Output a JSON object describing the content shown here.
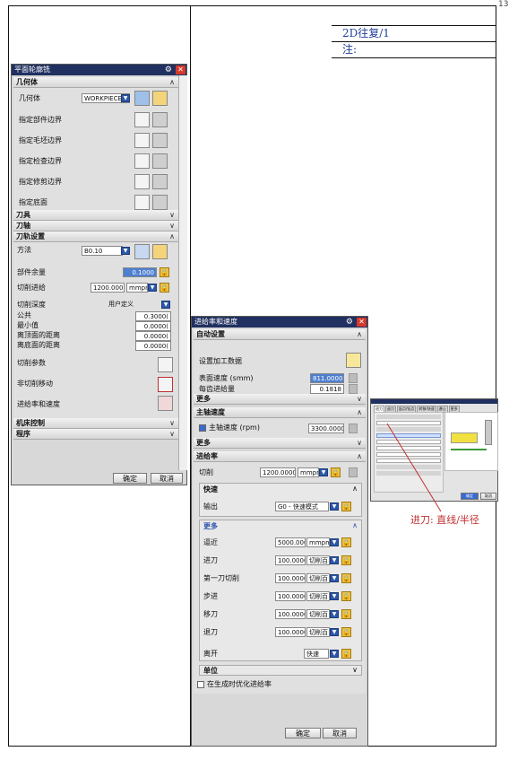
{
  "page_number": "13",
  "notes": {
    "line1": "2D往复/1",
    "line2": "注:"
  },
  "annotation": "进刀: 直线/半径",
  "dialog1": {
    "title": "平面轮廓铣",
    "geometry": {
      "header": "几何体",
      "geometry_label": "几何体",
      "geometry_value": "WORKPIECE_",
      "rows": [
        "指定部件边界",
        "指定毛坯边界",
        "指定检查边界",
        "指定修剪边界",
        "指定底面"
      ]
    },
    "tool_header": "刀具",
    "axis_header": "刀轴",
    "path": {
      "header": "刀轨设置",
      "method_label": "方法",
      "method_value": "B0.10",
      "stock_label": "部件余量",
      "stock_value": "0.1000",
      "stepover_label": "切削进给",
      "stepover_value": "1200.000(",
      "stepover_unit": "mmpm",
      "depth_label": "切削深度",
      "depth_value": "用户定义",
      "tol_label": "公共",
      "tol_value": "0.3000(",
      "min_label": "最小值",
      "min_value": "0.0000(",
      "top_label": "离顶面的距离",
      "top_value": "0.0000(",
      "bottom_label": "离底面的距离",
      "bottom_value": "0.0000(",
      "params_label": "切削参数",
      "noncut_label": "非切削移动",
      "feeds_label": "进给率和速度"
    },
    "machine_header": "机床控制",
    "program_header": "程序",
    "ok": "确定",
    "cancel": "取消"
  },
  "dialog2": {
    "title": "进给率和速度",
    "auto": {
      "header": "自动设置",
      "set_label": "设置加工数据",
      "speed_label": "表面速度 (smm)",
      "speed_value": "811.0000",
      "feed_label": "每齿进给量",
      "feed_value": "0.1818"
    },
    "more1": "更多",
    "spindle": {
      "header": "主轴速度",
      "rpm_label": "主轴速度 (rpm)",
      "rpm_value": "3300.0000"
    },
    "more2": "更多",
    "feedrate": {
      "header": "进给率",
      "cut_label": "切削",
      "cut_value": "1200.0000",
      "cut_unit": "mmpm",
      "rapid_header": "快速",
      "output_label": "输出",
      "output_value": "G0 - 快速模式",
      "more_header": "更多",
      "rows": [
        {
          "label": "逼近",
          "value": "5000.0000",
          "unit": "mmpm"
        },
        {
          "label": "进刀",
          "value": "100.0000",
          "unit": "切削百"
        },
        {
          "label": "第一刀切削",
          "value": "100.0000",
          "unit": "切削百"
        },
        {
          "label": "步进",
          "value": "100.0000",
          "unit": "切削百"
        },
        {
          "label": "移刀",
          "value": "100.0000",
          "unit": "切削百"
        },
        {
          "label": "退刀",
          "value": "100.0000",
          "unit": "切削百"
        }
      ],
      "depart_label": "离开",
      "depart_value": "快速",
      "units_header": "单位",
      "optimize_label": "在生成时优化进给率"
    },
    "ok": "确定",
    "cancel": "取消"
  },
  "thumb": {
    "tabs": [
      "进刀",
      "退刀",
      "起点/钻点",
      "转移/快速",
      "避让",
      "更多"
    ],
    "ok": "确定",
    "cancel": "取消"
  }
}
